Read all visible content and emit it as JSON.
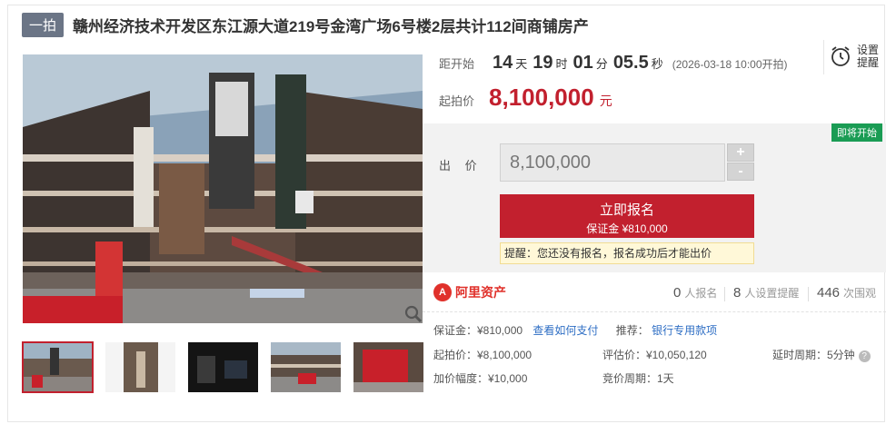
{
  "header": {
    "tag": "一拍",
    "title": "赣州经济技术开发区东江源大道219号金湾广场6号楼2层共计112间商铺房产"
  },
  "countdown": {
    "label": "距开始",
    "days": "14",
    "days_unit": "天",
    "hours": "19",
    "hours_unit": "时",
    "minutes": "01",
    "minutes_unit": "分",
    "seconds": "05.5",
    "seconds_unit": "秒",
    "start_time": "(2026-03-18 10:00开拍)"
  },
  "start_price": {
    "label": "起拍价",
    "value": "8,100,000",
    "unit": "元"
  },
  "reminder": {
    "label": "设置提醒"
  },
  "bid": {
    "badge": "即将开始",
    "label": "出 价",
    "input_value": "8,100,000",
    "plus": "+",
    "minus": "-",
    "signup_label": "立即报名",
    "deposit_text": "保证金 ¥810,000",
    "tip": "提醒：您还没有报名，报名成功后才能出价"
  },
  "stats": {
    "logo_text": "阿里资产",
    "applicants": "0",
    "applicants_label": "人报名",
    "reminders": "8",
    "reminders_label": "人设置提醒",
    "views": "446",
    "views_label": "次围观"
  },
  "details": {
    "deposit": "保证金：¥810,000",
    "deposit_link": "查看如何支付",
    "recommend_label": "推荐：",
    "recommend_link": "银行专用款项",
    "start_price": "起拍价：¥8,100,000",
    "appraisal": "评估价：¥10,050,120",
    "delay": "延时周期：5分钟",
    "increment": "加价幅度：¥10,000",
    "cycle": "竞价周期：1天"
  },
  "colors": {
    "accent": "#c2202e",
    "badge": "#1a9c54",
    "link": "#2e6ec4"
  },
  "icons": [
    "zoom-icon",
    "alarm-clock-icon",
    "help-icon",
    "alibaba-logo-icon"
  ]
}
